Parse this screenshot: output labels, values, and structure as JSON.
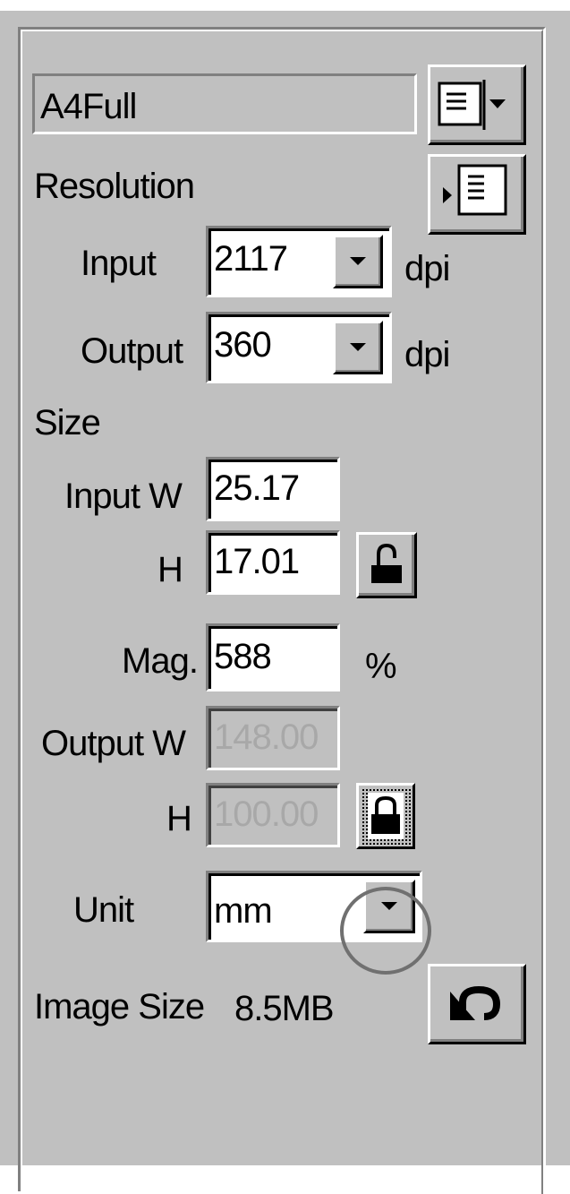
{
  "preset": {
    "name": "A4Full",
    "menu_icon": "list-dropdown-icon"
  },
  "resolution": {
    "heading": "Resolution",
    "menu_icon": "list-flyout-icon",
    "input_label": "Input",
    "input_value": "2117",
    "input_unit": "dpi",
    "output_label": "Output",
    "output_value": "360",
    "output_unit": "dpi"
  },
  "size": {
    "heading": "Size",
    "input_w_label": "Input W",
    "input_w_value": "25.17",
    "input_h_label": "H",
    "input_h_value": "17.01",
    "input_lock_icon": "unlocked-padlock-icon",
    "mag_label": "Mag.",
    "mag_value": "588",
    "mag_unit": "%",
    "output_w_label": "Output W",
    "output_w_value": "148.00",
    "output_h_label": "H",
    "output_h_value": "100.00",
    "output_lock_icon": "locked-padlock-icon"
  },
  "unit": {
    "label": "Unit",
    "value": "mm"
  },
  "image_size": {
    "label": "Image Size",
    "value": "8.5MB",
    "reset_icon": "undo-arrow-icon"
  }
}
